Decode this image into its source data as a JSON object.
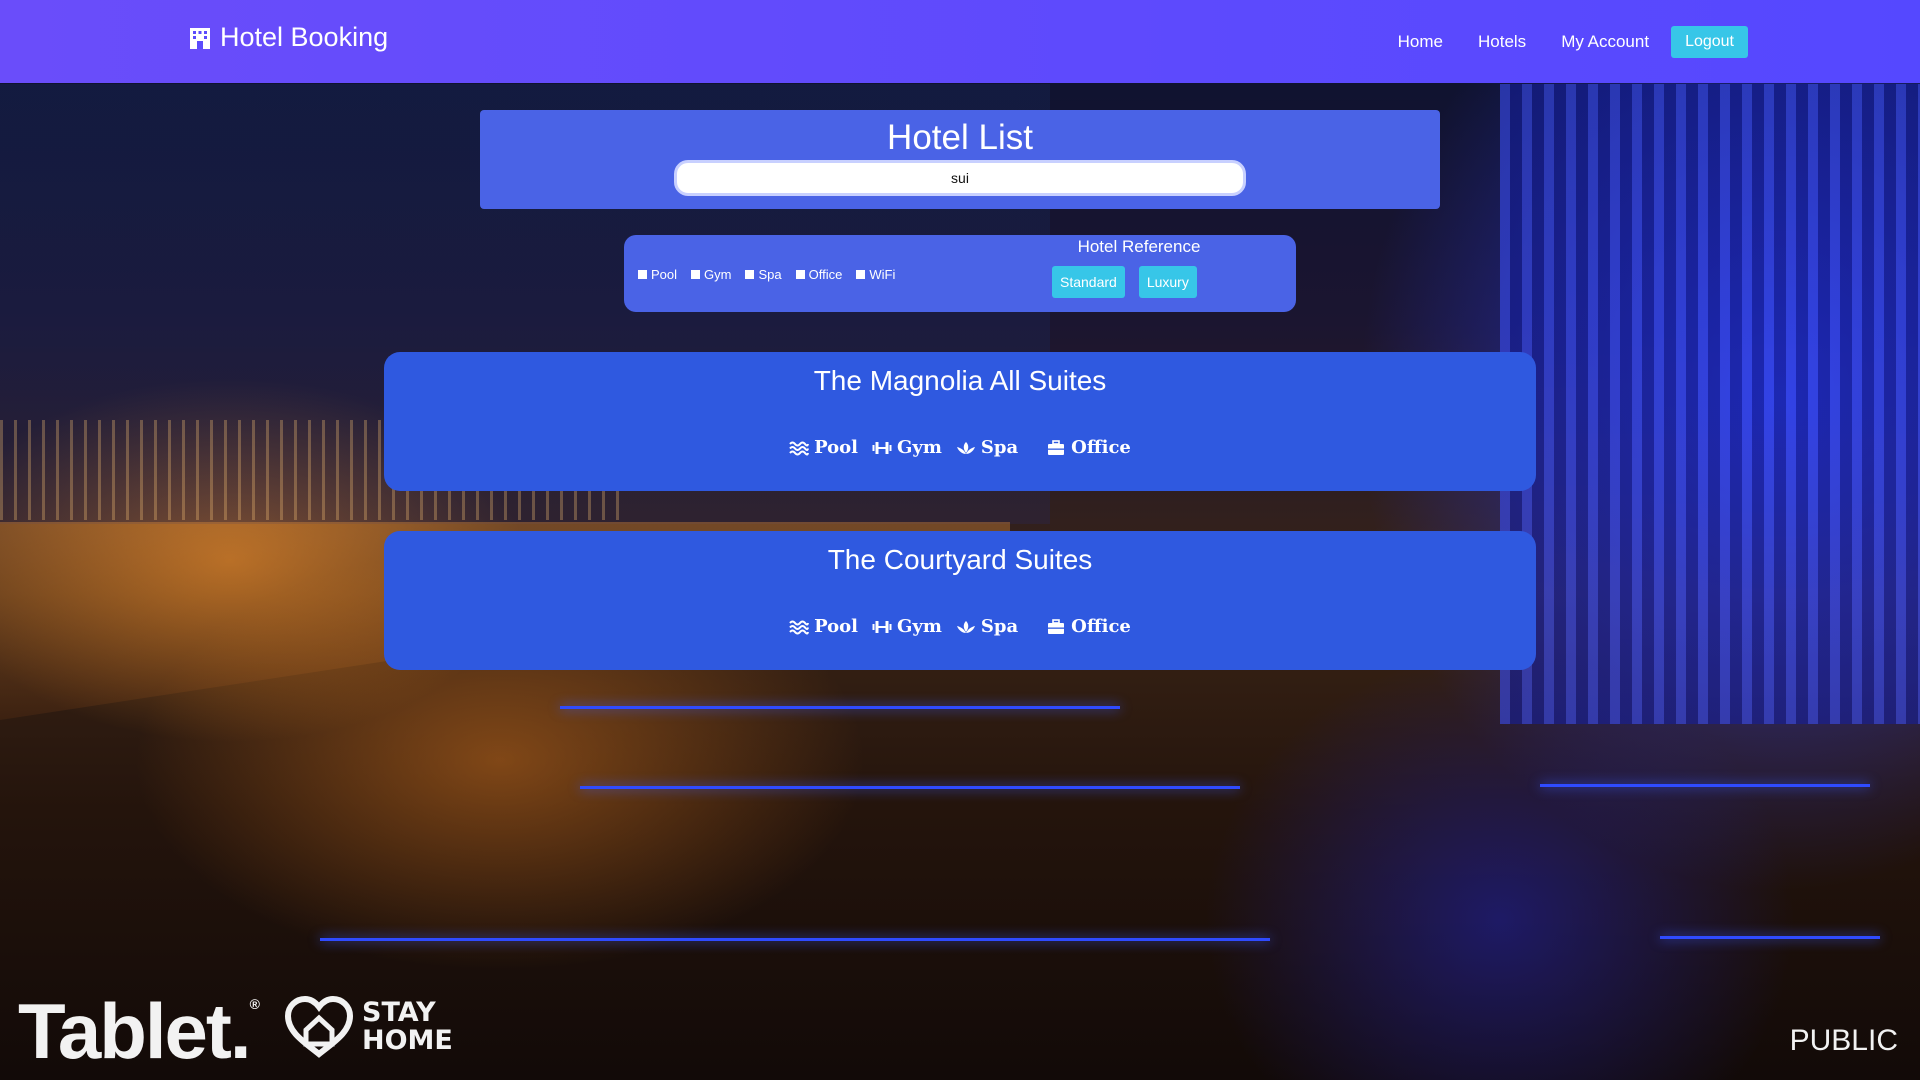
{
  "navbar": {
    "brand": "Hotel Booking",
    "brand_icon": "hotel-building-icon",
    "links": [
      "Home",
      "Hotels",
      "My Account"
    ],
    "logout": "Logout"
  },
  "header": {
    "title": "Hotel List",
    "search_value": "sui"
  },
  "filters": {
    "amenities": [
      "Pool",
      "Gym",
      "Spa",
      "Office",
      "WiFi"
    ],
    "reference_title": "Hotel Reference",
    "reference_buttons": [
      "Standard",
      "Luxury"
    ]
  },
  "hotels": [
    {
      "name": "The Magnolia All Suites",
      "amenities": [
        "Pool",
        "Gym",
        "Spa",
        "Office"
      ]
    },
    {
      "name": "The Courtyard Suites",
      "amenities": [
        "Pool",
        "Gym",
        "Spa",
        "Office"
      ]
    }
  ],
  "overlays": {
    "tablet_logo": "Tablet.",
    "tablet_reg": "®",
    "stay_home_line1": "STAY",
    "stay_home_line2": "HOME",
    "public_label": "PUBLIC"
  },
  "colors": {
    "navbar": "#5b4bfd",
    "panel": "#4a63e6",
    "card": "#2f59e0",
    "button": "#37c6e8"
  }
}
